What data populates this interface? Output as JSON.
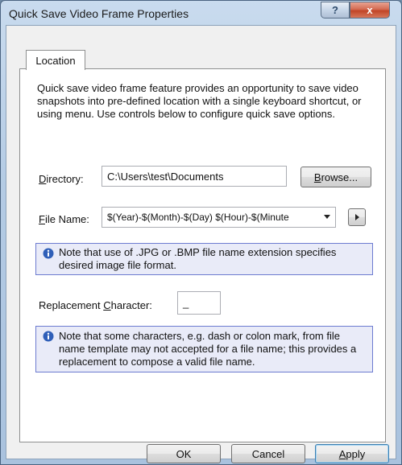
{
  "window": {
    "title": "Quick Save Video Frame Properties",
    "help_symbol": "?",
    "close_symbol": "x"
  },
  "tabs": [
    {
      "label": "Location",
      "active": true
    }
  ],
  "description": "Quick save video frame feature provides an opportunity to save video snapshots into pre-defined location with a single keyboard shortcut, or using menu. Use controls below to configure quick save options.",
  "directory": {
    "label_accel": "D",
    "label_rest": "irectory:",
    "value": "C:\\Users\\test\\Documents",
    "browse_accel": "B",
    "browse_rest": "rowse..."
  },
  "file_name": {
    "label_accel": "F",
    "label_rest": "ile Name:",
    "value": "$(Year)-$(Month)-$(Day) $(Hour)-$(Minute"
  },
  "note_format": "Note that use of .JPG or .BMP file name extension specifies desired image file format.",
  "replacement": {
    "label_pre": "Replacement ",
    "label_accel": "C",
    "label_rest": "haracter:",
    "value": "_"
  },
  "note_chars": "Note that some characters, e.g. dash or colon mark, from file name template may not accepted for a file name; this provides a replacement to compose a valid file name.",
  "buttons": {
    "ok": "OK",
    "cancel": "Cancel",
    "apply_accel": "A",
    "apply_rest": "pply"
  },
  "colors": {
    "info_icon": "#2f5fb8",
    "note_bg": "#e9ebf8",
    "note_border": "#6c7bd0",
    "close_button": "#c94a2c"
  },
  "icons": [
    "help-icon",
    "close-icon",
    "info-icon",
    "dropdown-arrow-icon",
    "arrow-right-icon"
  ]
}
